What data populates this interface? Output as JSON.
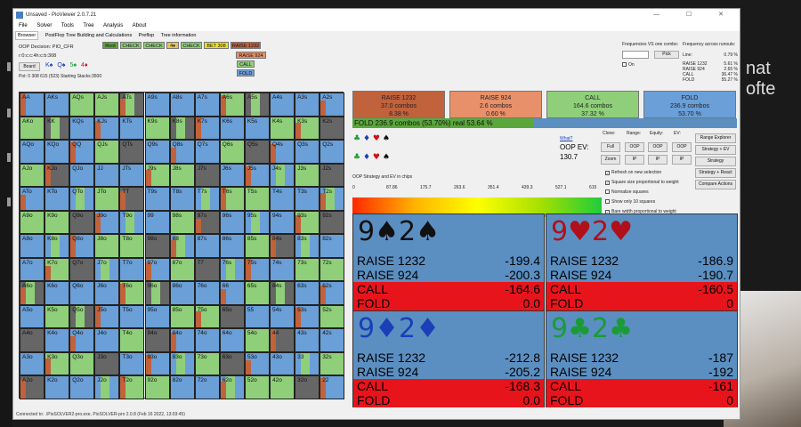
{
  "window": {
    "title": "Unsaved - PioViewer 2.0.7.21",
    "controls": "— ☐ ✕"
  },
  "menu": [
    "File",
    "Solver",
    "Tools",
    "Tree",
    "Analysis",
    "About"
  ],
  "tabs": [
    "Browser",
    "PostFlop Tree Building and Calculations",
    "Preflop",
    "Tree information"
  ],
  "decision": {
    "oop_decision": "OOP Decision:  PIO_CFR",
    "line": "r:0:c:c:4h:c:b:308",
    "board_button": "Board",
    "board_cards": [
      "K♠",
      "Q♠",
      "5♠",
      "4♦"
    ],
    "pot": "Pot: 0 308 615 (523) Starting Stacks:3500"
  },
  "path_buttons": [
    {
      "label": "Root",
      "color": "#5aa83a"
    },
    {
      "label": "CHECK",
      "color": "#8fcf7a"
    },
    {
      "label": "CHECK",
      "color": "#8fcf7a"
    },
    {
      "label": "4♦",
      "color": "#e8c35a"
    },
    {
      "label": "CHECK",
      "color": "#8fcf7a"
    },
    {
      "label": "BET 308",
      "color": "#f0e020"
    },
    {
      "label": "RAISE 1232",
      "color": "#c0623c"
    }
  ],
  "sub_actions": [
    {
      "label": "RAISE 924",
      "color": "#e8906a"
    },
    {
      "label": "CALL",
      "color": "#8fcf7a"
    },
    {
      "label": "FOLD",
      "color": "#6a9fd8"
    }
  ],
  "freq_panel": {
    "title": "Frequencies VS one combo:",
    "pick": "Pick",
    "on": "On",
    "runouts_title": "Frequency across runouts:",
    "line_label": "Line:",
    "line_val": "0.79 %",
    "rows": [
      [
        "RAISE 1232",
        "5.61 %"
      ],
      [
        "RAISE 924",
        "2.65 %"
      ],
      [
        "CALL",
        "36.47 %"
      ],
      [
        "FOLD",
        "55.27 %"
      ]
    ]
  },
  "grid": [
    [
      "AA",
      "AKs",
      "AQs",
      "AJs",
      "ATs",
      "A9s",
      "A8s",
      "A7s",
      "A6s",
      "A5s",
      "A4s",
      "A3s",
      "A2s"
    ],
    [
      "AKo",
      "KK",
      "KQs",
      "KJs",
      "KTs",
      "K9s",
      "K8s",
      "K7s",
      "K6s",
      "K5s",
      "K4s",
      "K3s",
      "K2s"
    ],
    [
      "AQo",
      "KQo",
      "QQ",
      "QJs",
      "QTs",
      "Q9s",
      "Q8s",
      "Q7s",
      "Q6s",
      "Q5s",
      "Q4s",
      "Q3s",
      "Q2s"
    ],
    [
      "AJo",
      "KJo",
      "QJo",
      "JJ",
      "JTs",
      "J9s",
      "J8s",
      "J7s",
      "J6s",
      "J5s",
      "J4s",
      "J3s",
      "J2s"
    ],
    [
      "ATo",
      "KTo",
      "QTo",
      "JTo",
      "TT",
      "T9s",
      "T8s",
      "T7s",
      "T6s",
      "T5s",
      "T4s",
      "T3s",
      "T2s"
    ],
    [
      "A9o",
      "K9o",
      "Q9o",
      "J9o",
      "T9o",
      "99",
      "98s",
      "97s",
      "96s",
      "95s",
      "94s",
      "93s",
      "92s"
    ],
    [
      "A8o",
      "K8o",
      "Q8o",
      "J8o",
      "T8o",
      "98o",
      "88",
      "87s",
      "86s",
      "85s",
      "84s",
      "83s",
      "82s"
    ],
    [
      "A7o",
      "K7o",
      "Q7o",
      "J7o",
      "T7o",
      "97o",
      "87o",
      "77",
      "76s",
      "75s",
      "74s",
      "73s",
      "72s"
    ],
    [
      "A6o",
      "K6o",
      "Q6o",
      "J6o",
      "T6o",
      "96o",
      "86o",
      "76o",
      "66",
      "65s",
      "64s",
      "63s",
      "62s"
    ],
    [
      "A5o",
      "K5o",
      "Q5o",
      "J5o",
      "T5o",
      "95o",
      "85o",
      "75o",
      "65o",
      "55",
      "54s",
      "53s",
      "52s"
    ],
    [
      "A4o",
      "K4o",
      "Q4o",
      "J4o",
      "T4o",
      "94o",
      "84o",
      "74o",
      "64o",
      "54o",
      "44",
      "43s",
      "42s"
    ],
    [
      "A3o",
      "K3o",
      "Q3o",
      "J3o",
      "T3o",
      "93o",
      "83o",
      "73o",
      "63o",
      "53o",
      "43o",
      "33",
      "32s"
    ],
    [
      "A2o",
      "K2o",
      "Q2o",
      "J2o",
      "T2o",
      "92o",
      "82o",
      "72o",
      "62o",
      "52o",
      "42o",
      "32o",
      "22"
    ]
  ],
  "summary": [
    {
      "name": "RAISE 1232",
      "combos": "37.0 combos",
      "pct": "8.38 %",
      "color": "#c0623c"
    },
    {
      "name": "RAISE 924",
      "combos": "2.6 combos",
      "pct": "0.60 %",
      "color": "#e8906a"
    },
    {
      "name": "CALL",
      "combos": "164.6 combos",
      "pct": "37.32 %",
      "color": "#8fcf7a"
    },
    {
      "name": "FOLD",
      "combos": "236.9 combos",
      "pct": "53.70 %",
      "color": "#6a9fd8"
    }
  ],
  "foldbar": {
    "text": "FOLD  236.9 combos (53.70%) real  53.64 %",
    "fill_fraction": 0.47
  },
  "suits_row1": [
    "♣",
    "♦",
    "♥",
    "♠"
  ],
  "suits_row2": [
    "♣",
    "♦",
    "♥",
    "♠"
  ],
  "what_link": "What?",
  "oop_ev_label": "OOP EV:",
  "oop_ev_value": "130.7",
  "ctrl_headers": [
    "Clone:",
    "Range:",
    "Equity:",
    "EV:"
  ],
  "ctrl_buttons": [
    [
      "Full",
      "OOP",
      "OOP",
      "OOP"
    ],
    [
      "Zoom",
      "IP",
      "IP",
      "IP"
    ]
  ],
  "right_buttons": [
    "Range Explorer",
    "Strategy + EV",
    "Strategy",
    "Strategy + React",
    "Compare Actions"
  ],
  "checkboxes": [
    {
      "label": "Refresh on new selection",
      "checked": true
    },
    {
      "label": "Square size proportional to weight",
      "checked": true
    },
    {
      "label": "Normalize squares",
      "checked": false
    },
    {
      "label": "Show only 10 squares",
      "checked": false
    },
    {
      "label": "Bare width proportional to weight",
      "checked": true
    }
  ],
  "gradient": {
    "title": "OOP Strategy and EV in chips",
    "ticks": [
      "0",
      "87.86",
      "175.7",
      "263.6",
      "351.4",
      "439.3",
      "527.1",
      "615"
    ]
  },
  "combos": [
    {
      "cards": "9♠2♠",
      "color": "#111",
      "rows": [
        [
          "RAISE 1232",
          "-199.4"
        ],
        [
          "RAISE 924",
          "-200.3"
        ],
        [
          "CALL",
          "-164.6"
        ],
        [
          "FOLD",
          "0.0"
        ]
      ]
    },
    {
      "cards": "9♥2♥",
      "color": "#b0101a",
      "rows": [
        [
          "RAISE 1232",
          "-186.9"
        ],
        [
          "RAISE 924",
          "-190.7"
        ],
        [
          "CALL",
          "-160.5"
        ],
        [
          "FOLD",
          "0"
        ]
      ]
    },
    {
      "cards": "9♦2♦",
      "color": "#1a3fb8",
      "rows": [
        [
          "RAISE 1232",
          "-212.8"
        ],
        [
          "RAISE 924",
          "-205.2"
        ],
        [
          "CALL",
          "-168.3"
        ],
        [
          "FOLD",
          "0.0"
        ]
      ]
    },
    {
      "cards": "9♣2♣",
      "color": "#1c9a3a",
      "rows": [
        [
          "RAISE 1232",
          "-187"
        ],
        [
          "RAISE 924",
          "-192"
        ],
        [
          "CALL",
          "-161"
        ],
        [
          "FOLD",
          "0"
        ]
      ]
    }
  ],
  "status": "Connected to: .\\PioSOLVER2-pro.exe, PioSOLVER-pro 2.0.8 (Feb 16 2022, 13:03:45)",
  "background_text": "nat ofte"
}
